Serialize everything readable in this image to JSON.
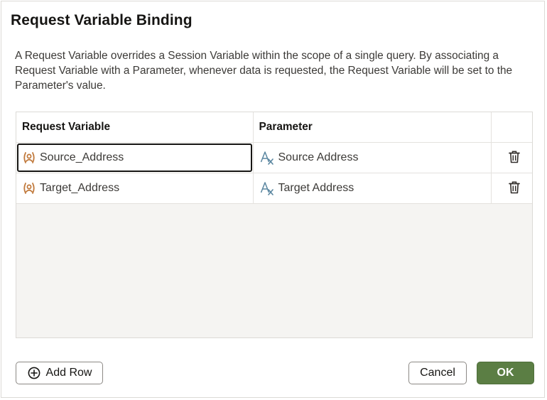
{
  "dialog": {
    "title": "Request Variable Binding",
    "description": "A Request Variable overrides a Session Variable within the scope of a single query. By associating a Request Variable with a Parameter, whenever data is requested, the Request Variable will be set to the Parameter's value."
  },
  "table": {
    "columns": [
      "Request Variable",
      "Parameter",
      ""
    ],
    "rows": [
      {
        "request_variable": "Source_Address",
        "parameter": "Source Address",
        "variable_icon": "request-variable-icon",
        "parameter_icon": "text-parameter-icon",
        "action_icon": "trash-icon"
      },
      {
        "request_variable": "Target_Address",
        "parameter": "Target Address",
        "variable_icon": "request-variable-icon",
        "parameter_icon": "text-parameter-icon",
        "action_icon": "trash-icon"
      }
    ],
    "focused_row": 0
  },
  "footer": {
    "add_row_label": "Add Row",
    "add_row_icon": "plus-circle-icon",
    "cancel_label": "Cancel",
    "ok_label": "OK"
  },
  "colors": {
    "variable_icon": "#c0783a",
    "parameter_icon": "#5a86a0",
    "ok_button": "#5b7e44",
    "focus_border": "#161513"
  }
}
